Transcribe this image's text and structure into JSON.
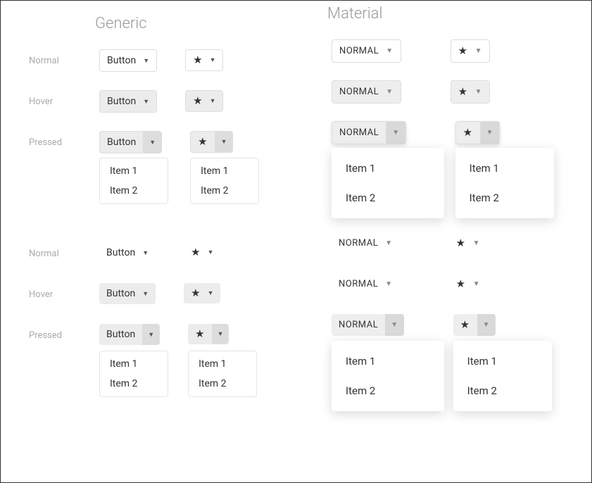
{
  "titles": {
    "generic": "Generic",
    "material": "Material"
  },
  "states": {
    "normal": "Normal",
    "hover": "Hover",
    "pressed": "Pressed"
  },
  "generic": {
    "button_label": "Button"
  },
  "material": {
    "button_label": "NORMAL"
  },
  "menu": {
    "item1": "Item 1",
    "item2": "Item 2"
  },
  "icons": {
    "star": "★",
    "caret": "▼"
  }
}
